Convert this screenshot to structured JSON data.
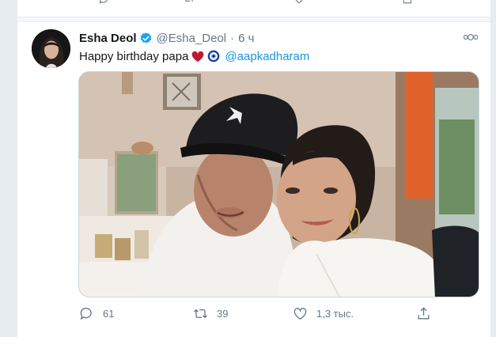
{
  "tweet": {
    "author_name": "Esha Deol",
    "author_handle": "@Esha_Deol",
    "separator": "·",
    "time": "6 ч",
    "text": "Happy birthday papa",
    "mention": "@aapkadharam"
  },
  "actions": {
    "reply_count": "61",
    "retweet_count": "39",
    "like_count": "1,3 тыс."
  },
  "icons": {
    "verified": "verified-badge-icon",
    "more": "more-dots-icon",
    "heart_emoji": "red-heart-emoji",
    "nazar_emoji": "nazar-amulet-emoji",
    "reply": "reply-icon",
    "retweet": "retweet-icon",
    "like": "like-icon",
    "share": "share-icon"
  },
  "colors": {
    "accent": "#1b95e0",
    "verified": "#1da1f2",
    "secondary_text": "#657786",
    "heart": "#be1931"
  }
}
